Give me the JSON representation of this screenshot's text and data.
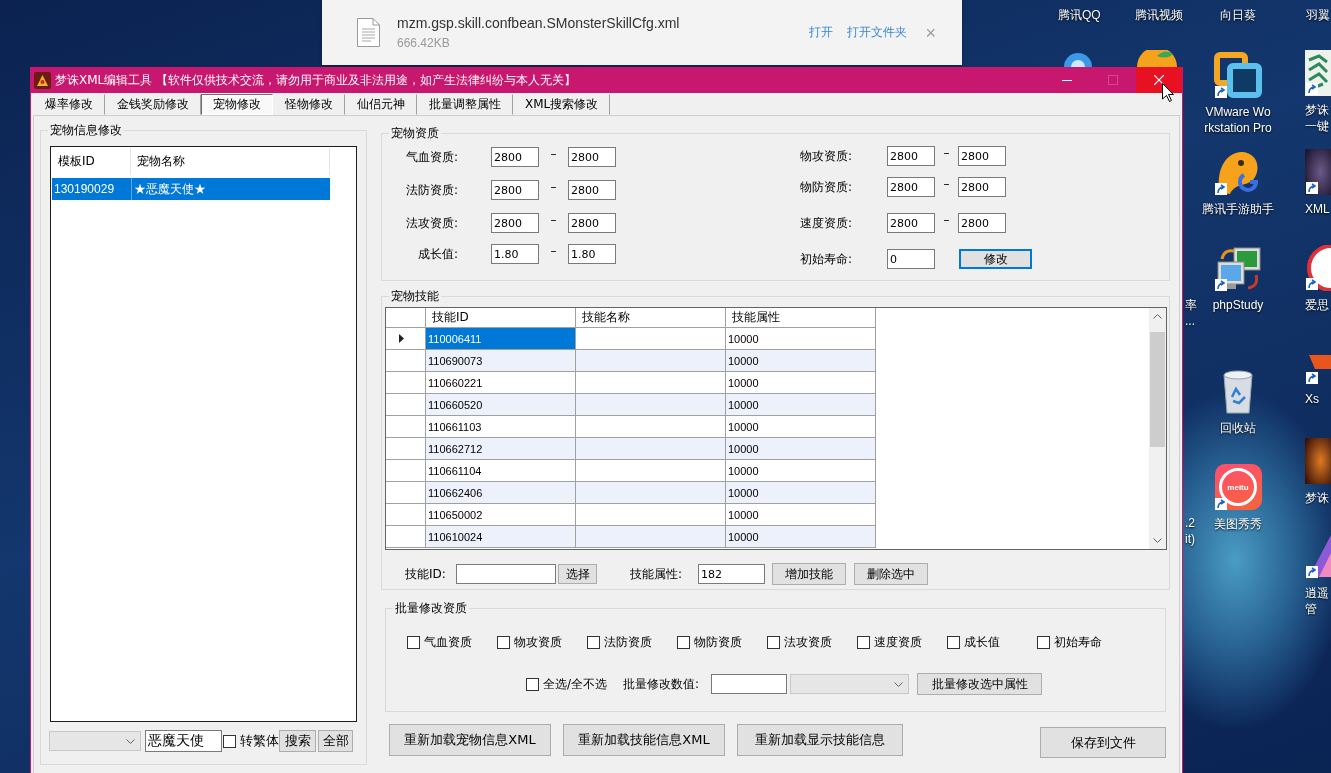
{
  "desktop": {
    "top_labels": [
      "腾讯QQ",
      "腾讯视频",
      "向日葵",
      "羽翼"
    ],
    "shortcuts": [
      {
        "kind": "vmware",
        "label": "VMware Wo\nrkstation Pro",
        "shortcut": true
      },
      {
        "kind": "game-helper",
        "label": "腾讯手游助手",
        "shortcut": true
      },
      {
        "kind": "php-study",
        "label": "phpStudy",
        "shortcut": true
      },
      {
        "kind": "recycle-bin",
        "label": "回收站",
        "shortcut": false
      },
      {
        "kind": "meitu",
        "label": "美图秀秀",
        "logo_text": "meitu",
        "shortcut": true
      }
    ],
    "edge_shortcuts": [
      {
        "kind": "emblem",
        "label": "梦诛一键",
        "shortcut": true
      },
      {
        "kind": "photo",
        "label": "XML",
        "shortcut": true
      },
      {
        "kind": "ring",
        "label": "爱思",
        "shortcut": true
      },
      {
        "kind": "flame",
        "label": "Xs",
        "shortcut": true
      },
      {
        "kind": "photo",
        "label": "梦诛",
        "shortcut": false
      },
      {
        "kind": "triangle",
        "label": "逍遥管",
        "shortcut": true
      }
    ],
    "fragments": [
      "率\n...",
      ".2\nit)"
    ],
    "download": {
      "file_name": "mzm.gsp.skill.confbean.SMonsterSkillCfg.xml",
      "size": "666.42KB",
      "actions": [
        "打开",
        "打开文件夹"
      ],
      "close": "×"
    }
  },
  "window": {
    "title": "梦诛XML编辑工具 【软件仅供技术交流，请勿用于商业及非法用途，如产生法律纠纷与本人无关】",
    "controls": [
      {
        "kind": "minimize",
        "disabled": false,
        "hovered": false
      },
      {
        "kind": "maximize",
        "disabled": true,
        "hovered": false
      },
      {
        "kind": "close",
        "disabled": false,
        "hovered": true
      }
    ]
  },
  "tabs": [
    {
      "label": "爆率修改",
      "selected": false
    },
    {
      "label": "金钱奖励修改",
      "selected": false
    },
    {
      "label": "宠物修改",
      "selected": true
    },
    {
      "label": "怪物修改",
      "selected": false
    },
    {
      "label": "仙侣元神",
      "selected": false
    },
    {
      "label": "批量调整属性",
      "selected": false
    },
    {
      "label": "XML搜索修改",
      "selected": false
    }
  ],
  "pet_list": {
    "title": "宠物信息修改",
    "columns": [
      "模板ID",
      "宠物名称"
    ],
    "rows": [
      {
        "id": "130190029",
        "name": "★恶魔天使★",
        "selected": true
      }
    ],
    "filter": {
      "combo": {
        "disabled": true
      },
      "search": "恶魔天使",
      "traditional": {
        "label": "转繁体",
        "checked": false
      },
      "buttons": [
        "搜索",
        "全部"
      ]
    }
  },
  "aptitude": {
    "title": "宠物资质",
    "left": [
      {
        "label": "气血资质:",
        "min": "2800",
        "separator": "–",
        "max": "2800"
      },
      {
        "label": "法防资质:",
        "min": "2800",
        "separator": "–",
        "max": "2800"
      },
      {
        "label": "法攻资质:",
        "min": "2800",
        "separator": "–",
        "max": "2800"
      },
      {
        "label": "成长值:",
        "min": "1.80",
        "separator": "–",
        "max": "1.80"
      }
    ],
    "right": [
      {
        "label": "物攻资质:",
        "min": "2800",
        "separator": "–",
        "max": "2800"
      },
      {
        "label": "物防资质:",
        "min": "2800",
        "separator": "–",
        "max": "2800"
      },
      {
        "label": "速度资质:",
        "min": "2800",
        "separator": "–",
        "max": "2800"
      }
    ],
    "lifespan": {
      "label": "初始寿命:",
      "value": "0"
    },
    "button": {
      "label": "修改",
      "default": true
    }
  },
  "skills": {
    "title": "宠物技能",
    "columns": [
      "技能ID",
      "技能名称",
      "技能属性"
    ],
    "rows": [
      {
        "id": "110006411",
        "attribute": "10000",
        "selected": true
      },
      {
        "id": "110690073",
        "attribute": "10000",
        "selected": false
      },
      {
        "id": "110660221",
        "attribute": "10000",
        "selected": false
      },
      {
        "id": "110660520",
        "attribute": "10000",
        "selected": false
      },
      {
        "id": "110661103",
        "attribute": "10000",
        "selected": false
      },
      {
        "id": "110662712",
        "attribute": "10000",
        "selected": false
      },
      {
        "id": "110661104",
        "attribute": "10000",
        "selected": false
      },
      {
        "id": "110662406",
        "attribute": "10000",
        "selected": false
      },
      {
        "id": "110650002",
        "attribute": "10000",
        "selected": false
      },
      {
        "id": "110610024",
        "attribute": "10000",
        "selected": false
      }
    ],
    "id_label": "技能ID:",
    "choose_button": "选择",
    "attribute_label": "技能属性:",
    "attribute_value": "182",
    "buttons": [
      "增加技能",
      "删除选中"
    ]
  },
  "batch": {
    "title": "批量修改资质",
    "options": [
      {
        "label": "气血资质",
        "checked": false
      },
      {
        "label": "物攻资质",
        "checked": false
      },
      {
        "label": "法防资质",
        "checked": false
      },
      {
        "label": "物防资质",
        "checked": false
      },
      {
        "label": "法攻资质",
        "checked": false
      },
      {
        "label": "速度资质",
        "checked": false
      },
      {
        "label": "成长值",
        "checked": false
      },
      {
        "label": "初始寿命",
        "checked": false
      }
    ],
    "select_all": {
      "label": "全选/全不选",
      "checked": false
    },
    "value_label": "批量修改数值:",
    "combo": {
      "disabled": true
    },
    "button": "批量修改选中属性"
  },
  "actions": [
    "重新加载宠物信息XML",
    "重新加载技能信息XML",
    "重新加载显示技能信息"
  ],
  "save_button": "保存到文件"
}
